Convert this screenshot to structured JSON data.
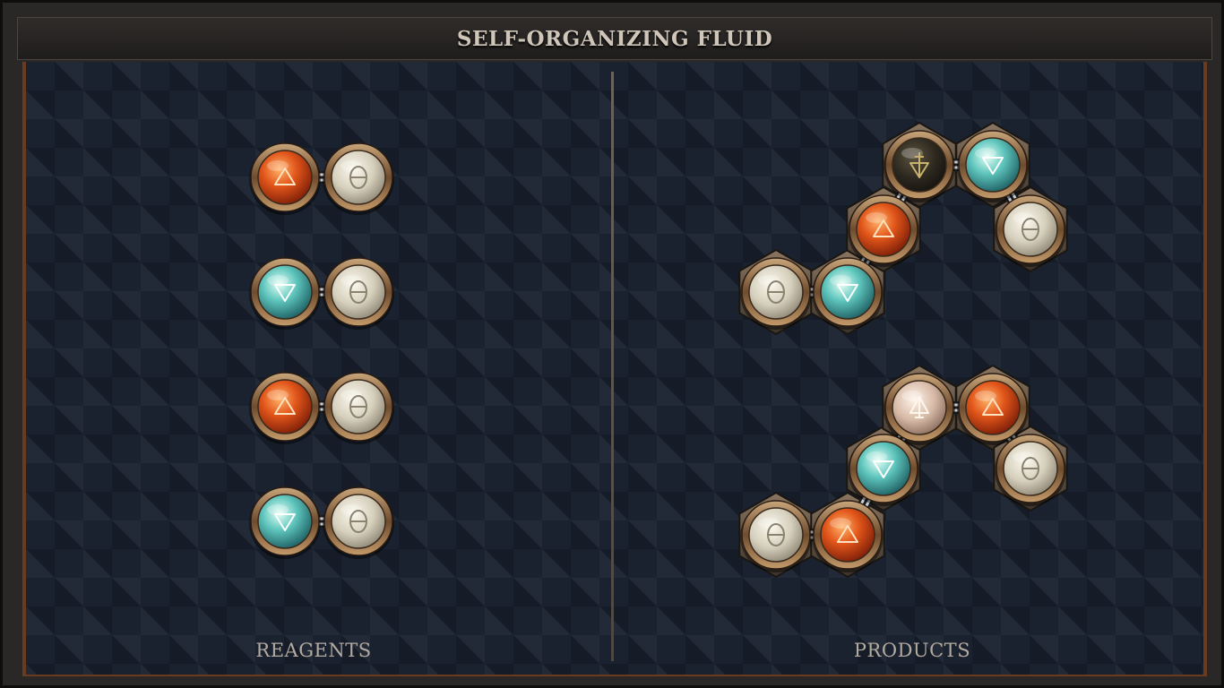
{
  "title": "SELF-ORGANIZING FLUID",
  "sections": {
    "reagents_label": "REAGENTS",
    "products_label": "PRODUCTS"
  },
  "colors": {
    "fire": "#e05a1a",
    "water": "#5ac8c0",
    "salt": "#d8d2bf",
    "vitae": "#d9c0ae",
    "mors": "#3a3426",
    "frame_wood": "#6b3a1f",
    "board": "#1a2230"
  },
  "elements": {
    "fire": {
      "symbol": "fire-triangle-icon"
    },
    "water": {
      "symbol": "water-triangle-icon"
    },
    "salt": {
      "symbol": "salt-theta-icon"
    },
    "vitae": {
      "symbol": "vitae-icon"
    },
    "mors": {
      "symbol": "mors-icon"
    }
  },
  "reagents": [
    {
      "atoms": [
        "fire",
        "salt"
      ]
    },
    {
      "atoms": [
        "water",
        "salt"
      ]
    },
    {
      "atoms": [
        "fire",
        "salt"
      ]
    },
    {
      "atoms": [
        "water",
        "salt"
      ]
    }
  ],
  "products": [
    {
      "atoms": [
        "salt",
        "water",
        "fire",
        "mors",
        "water",
        "salt"
      ]
    },
    {
      "atoms": [
        "salt",
        "fire",
        "water",
        "vitae",
        "fire",
        "salt"
      ]
    }
  ]
}
